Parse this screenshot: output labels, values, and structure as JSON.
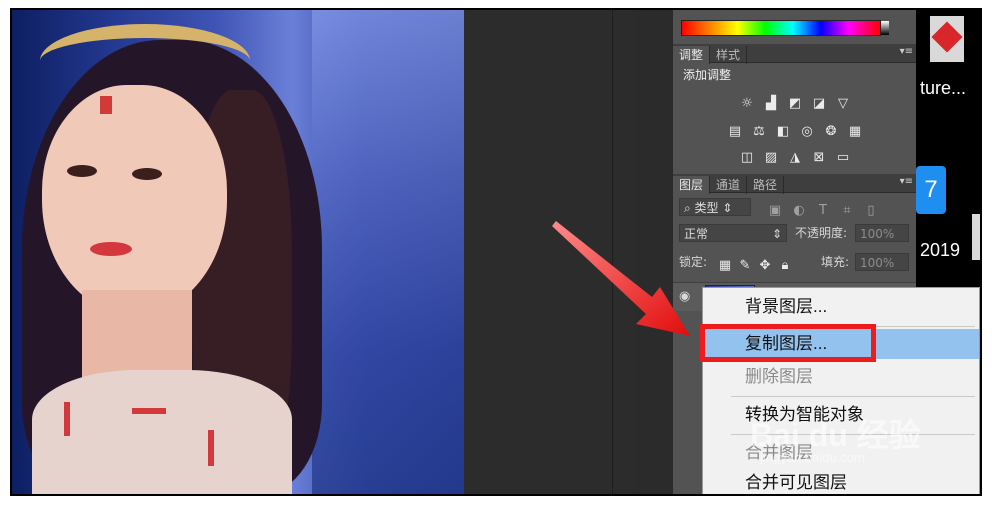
{
  "panel": {
    "tabs_adjust": [
      "调整",
      "样式"
    ],
    "adjust_title": "添加调整",
    "tabs_layers": [
      "图层",
      "通道",
      "路径"
    ],
    "filter_kind": "类型",
    "blend_mode": "正常",
    "opacity_label": "不透明度:",
    "opacity_value": "100%",
    "lock_label": "锁定:",
    "fill_label": "填充:",
    "fill_value": "100%",
    "menu_icon": "panel-menu-icon"
  },
  "context_menu": {
    "items": [
      {
        "label": "背景图层...",
        "enabled": true
      },
      {
        "label": "复制图层...",
        "enabled": true,
        "highlighted": true
      },
      {
        "label": "删除图层",
        "enabled": false
      },
      {
        "label": "转换为智能对象",
        "enabled": true
      },
      {
        "label": "合并图层",
        "enabled": false
      },
      {
        "label": "合并可见图层",
        "enabled": true
      }
    ]
  },
  "desktop": {
    "label_1": "ture...",
    "label_2": "2019"
  },
  "watermark": {
    "logo": "Bai du 经验",
    "url": "jingyan.baidu.com"
  },
  "colors": {
    "highlight": "#93c2ee",
    "annotation_red": "#ee1c1c",
    "panel_bg": "#535353"
  }
}
